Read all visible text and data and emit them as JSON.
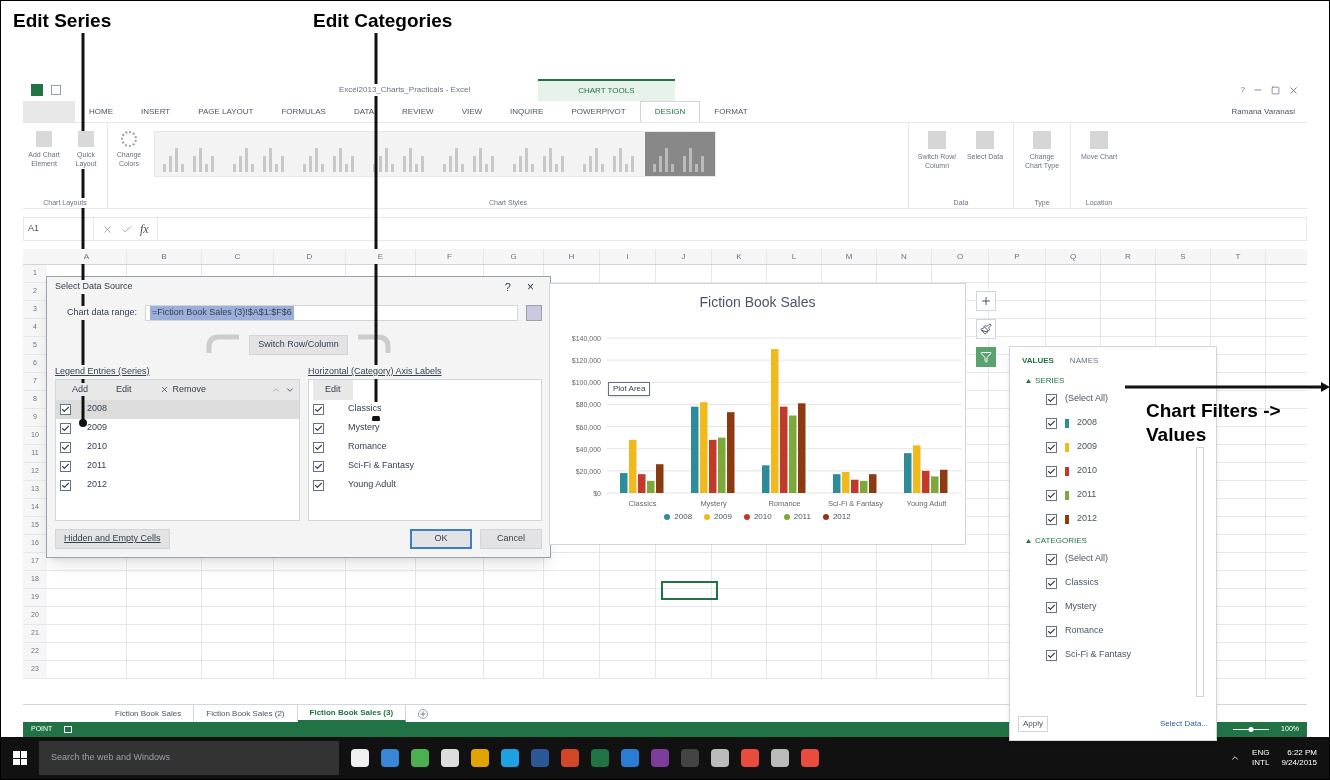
{
  "annotations": {
    "edit_series": "Edit Series",
    "edit_categories": "Edit Categories",
    "chart_filters": "Chart Filters -> Values"
  },
  "window": {
    "title": "Excel2013_Charts_Practicals - Excel",
    "context_tab": "CHART TOOLS",
    "help": "?",
    "user": "Ramana Varanasi"
  },
  "ribbon_tabs": [
    {
      "label": "HOME",
      "selected": false
    },
    {
      "label": "INSERT",
      "selected": false
    },
    {
      "label": "PAGE LAYOUT",
      "selected": false
    },
    {
      "label": "FORMULAS",
      "selected": false
    },
    {
      "label": "DATA",
      "selected": false
    },
    {
      "label": "REVIEW",
      "selected": false
    },
    {
      "label": "VIEW",
      "selected": false
    },
    {
      "label": "INQUIRE",
      "selected": false
    },
    {
      "label": "POWERPIVOT",
      "selected": false
    },
    {
      "label": "DESIGN",
      "selected": true
    },
    {
      "label": "FORMAT",
      "selected": false
    }
  ],
  "ribbon": {
    "add_chart_element": "Add Chart Element",
    "quick_layout": "Quick Layout",
    "change_colors": "Change Colors",
    "chart_layouts": "Chart Layouts",
    "chart_styles_label": "Chart Styles",
    "chart_styles": [
      {
        "selected": false
      },
      {
        "selected": false
      },
      {
        "selected": false
      },
      {
        "selected": false
      },
      {
        "selected": false
      },
      {
        "selected": false
      },
      {
        "selected": false
      },
      {
        "selected": true
      }
    ],
    "switch_row_column": "Switch Row/ Column",
    "select_data": "Select Data",
    "data_label": "Data",
    "change_chart_type": "Change Chart Type",
    "type_label": "Type",
    "move_chart": "Move Chart",
    "location_label": "Location"
  },
  "formula_bar": {
    "name_box": "A1",
    "fx": "fx"
  },
  "columns": [
    "A",
    "B",
    "C",
    "D",
    "E",
    "F",
    "G",
    "H",
    "I",
    "J",
    "K",
    "L",
    "M",
    "N",
    "O",
    "P",
    "Q",
    "R",
    "S",
    "T"
  ],
  "rows": [
    "1",
    "2",
    "3",
    "4",
    "5",
    "6",
    "7",
    "8",
    "9",
    "10",
    "11",
    "12",
    "13",
    "14",
    "15",
    "16",
    "17",
    "18",
    "19",
    "20",
    "21",
    "22",
    "23"
  ],
  "dialog": {
    "title": "Select Data Source",
    "help": "?",
    "close": "×",
    "range_label": "Chart data range:",
    "range_value": "=Fiction Book Sales (3)!$A$1:$F$6",
    "switch": "Switch Row/Column",
    "series_label": "Legend Entries (Series)",
    "add": "Add",
    "edit": "Edit",
    "remove": "Remove",
    "series": [
      {
        "label": "2008",
        "checked": true,
        "selected": true
      },
      {
        "label": "2009",
        "checked": true,
        "selected": false
      },
      {
        "label": "2010",
        "checked": true,
        "selected": false
      },
      {
        "label": "2011",
        "checked": true,
        "selected": false
      },
      {
        "label": "2012",
        "checked": true,
        "selected": false
      }
    ],
    "categories_label": "Horizontal (Category) Axis Labels",
    "categories_edit": "Edit",
    "categories": [
      {
        "label": "Classics",
        "checked": true
      },
      {
        "label": "Mystery",
        "checked": true
      },
      {
        "label": "Romance",
        "checked": true
      },
      {
        "label": "Sci-Fi & Fantasy",
        "checked": true
      },
      {
        "label": "Young Adult",
        "checked": true
      }
    ],
    "hidden_cells": "Hidden and Empty Cells",
    "ok": "OK",
    "cancel": "Cancel"
  },
  "chart": {
    "tooltip": "Plot Area",
    "chart_data": {
      "type": "bar",
      "title": "Fiction Book Sales",
      "categories": [
        "Classics",
        "Mystery",
        "Romance",
        "Sci-Fi & Fantasy",
        "Young Adult"
      ],
      "series": [
        {
          "name": "2008",
          "color": "#2e8b9a",
          "values": [
            18000,
            78000,
            25000,
            17000,
            36000
          ]
        },
        {
          "name": "2009",
          "color": "#f2b91c",
          "values": [
            48000,
            82000,
            130000,
            19000,
            43000
          ]
        },
        {
          "name": "2010",
          "color": "#c0392b",
          "values": [
            17000,
            48000,
            78000,
            12000,
            20000
          ]
        },
        {
          "name": "2011",
          "color": "#7fa83a",
          "values": [
            11000,
            50000,
            70000,
            11000,
            15000
          ]
        },
        {
          "name": "2012",
          "color": "#8b3a12",
          "values": [
            26000,
            73000,
            81000,
            17000,
            21000
          ]
        }
      ],
      "ylim": [
        0,
        140000
      ],
      "grid": true,
      "legend": true,
      "yticks": [
        {
          "value": 0,
          "label": "$0"
        },
        {
          "value": 20000,
          "label": "$20,000"
        },
        {
          "value": 40000,
          "label": "$40,000"
        },
        {
          "value": 60000,
          "label": "$60,000"
        },
        {
          "value": 80000,
          "label": "$80,000"
        },
        {
          "value": 100000,
          "label": "$100,000"
        },
        {
          "value": 120000,
          "label": "$120,000"
        },
        {
          "value": 140000,
          "label": "$140,000"
        }
      ]
    }
  },
  "chart_buttons": [
    {
      "kind": "elements",
      "selected": false
    },
    {
      "kind": "styles",
      "selected": false
    },
    {
      "kind": "filters",
      "selected": true
    }
  ],
  "filter_panel": {
    "tabs": [
      {
        "label": "VALUES",
        "selected": true
      },
      {
        "label": "NAMES",
        "selected": false
      }
    ],
    "series_heading": "SERIES",
    "series_all": {
      "label": "(Select All)",
      "checked": true
    },
    "series": [
      {
        "label": "2008",
        "checked": true,
        "color": "#2e8b9a"
      },
      {
        "label": "2009",
        "checked": true,
        "color": "#f2b91c"
      },
      {
        "label": "2010",
        "checked": true,
        "color": "#c0392b"
      },
      {
        "label": "2011",
        "checked": true,
        "color": "#7fa83a"
      },
      {
        "label": "2012",
        "checked": true,
        "color": "#8b3a12"
      }
    ],
    "categories_heading": "CATEGORIES",
    "categories_all": {
      "label": "(Select All)",
      "checked": true
    },
    "categories": [
      {
        "label": "Classics",
        "checked": true
      },
      {
        "label": "Mystery",
        "checked": true
      },
      {
        "label": "Romance",
        "checked": true
      },
      {
        "label": "Sci-Fi & Fantasy",
        "checked": true
      }
    ],
    "apply": "Apply",
    "select_data": "Select Data..."
  },
  "sheet_tabs": [
    {
      "label": "Fiction Book Sales",
      "selected": false
    },
    {
      "label": "Fiction Book Sales (2)",
      "selected": false
    },
    {
      "label": "Fiction Book Sales (3)",
      "selected": true
    }
  ],
  "status_bar": {
    "mode": "POINT",
    "zoom": "100%",
    "level": 0.5
  },
  "taskbar": {
    "search_placeholder": "Search the web and Windows",
    "language": "ENG",
    "layout": "INTL",
    "time": "6:22 PM",
    "date": "9/24/2015"
  }
}
